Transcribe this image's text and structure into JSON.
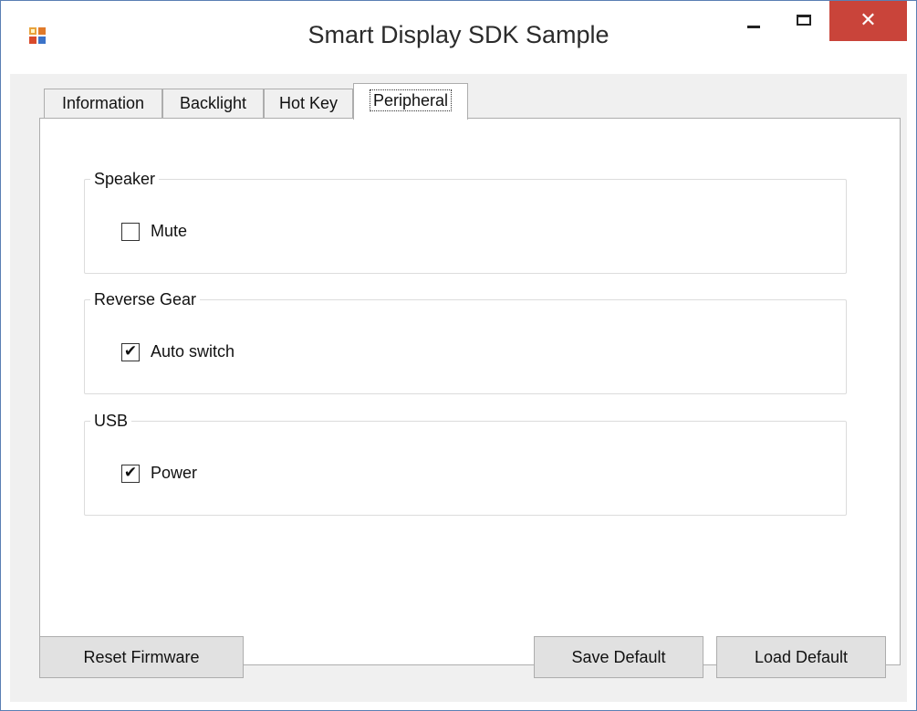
{
  "window": {
    "title": "Smart Display SDK Sample",
    "controls": {
      "minimize_icon": "minimize-icon",
      "maximize_icon": "maximize-icon",
      "close_icon": "close-icon",
      "close_glyph": "✕"
    },
    "accent_close": "#c9443a"
  },
  "tabs": [
    {
      "label": "Information",
      "selected": false
    },
    {
      "label": "Backlight",
      "selected": false
    },
    {
      "label": "Hot Key",
      "selected": false
    },
    {
      "label": "Peripheral",
      "selected": true
    }
  ],
  "groups": {
    "speaker": {
      "title": "Speaker",
      "checkbox": {
        "label": "Mute",
        "checked": false,
        "glyph": ""
      }
    },
    "reverse_gear": {
      "title": "Reverse Gear",
      "checkbox": {
        "label": "Auto switch",
        "checked": true,
        "glyph": "✔"
      }
    },
    "usb": {
      "title": "USB",
      "checkbox": {
        "label": "Power",
        "checked": true,
        "glyph": "✔"
      }
    }
  },
  "buttons": {
    "reset_firmware": "Reset Firmware",
    "save_default": "Save Default",
    "load_default": "Load Default"
  }
}
